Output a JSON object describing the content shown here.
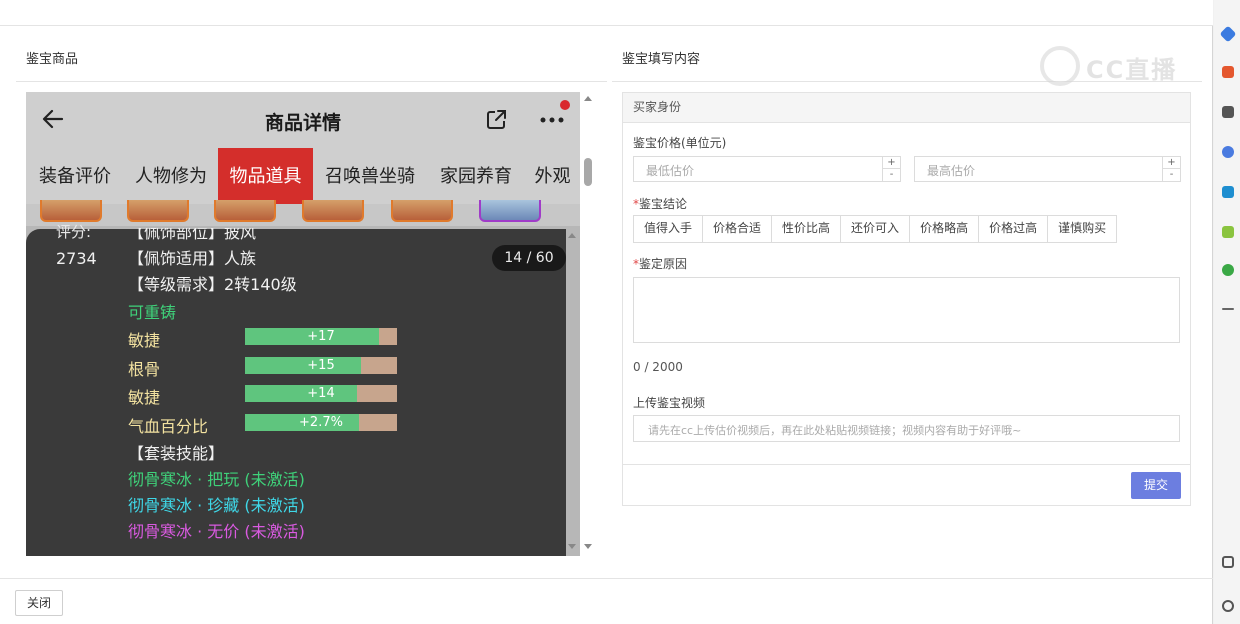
{
  "dialog": {
    "left_title": "鉴宝商品",
    "right_title": "鉴宝填写内容",
    "watermark": "CC直播",
    "close_label": "关闭"
  },
  "phone": {
    "title": "商品详情",
    "tabs": [
      {
        "label": "装备评价",
        "active": false
      },
      {
        "label": "人物修为",
        "active": false
      },
      {
        "label": "物品道具",
        "active": true
      },
      {
        "label": "召唤兽坐骑",
        "active": false
      },
      {
        "label": "家园养育",
        "active": false
      },
      {
        "label": "外观",
        "active": false
      }
    ],
    "card": {
      "score_label": "评分:",
      "score_value": "2734",
      "counter": "14 / 60",
      "line_top_cut": "【佩饰部位】披风",
      "line_race": "【佩饰适用】人族",
      "line_level": "【等级需求】2转140级",
      "recastable": "可重铸",
      "stats": [
        {
          "name": "敏捷",
          "value": "+17",
          "fill": 0.88
        },
        {
          "name": "根骨",
          "value": "+15",
          "fill": 0.76
        },
        {
          "name": "敏捷",
          "value": "+14",
          "fill": 0.74
        },
        {
          "name": "气血百分比",
          "value": "+2.7%",
          "fill": 0.75
        }
      ],
      "set_skill_title": "【套装技能】",
      "set_skills": [
        {
          "text": "彻骨寒冰 · 把玩 (未激活)",
          "color": "#3fd27a"
        },
        {
          "text": "彻骨寒冰 · 珍藏 (未激活)",
          "color": "#3fd8e8"
        },
        {
          "text": "彻骨寒冰 · 无价 (未激活)",
          "color": "#d95ae0"
        }
      ]
    }
  },
  "form": {
    "section": "买家身份",
    "price_label": "鉴宝价格(单位元)",
    "min_placeholder": "最低估价",
    "max_placeholder": "最高估价",
    "conclusion_label": "鉴宝结论",
    "conclusions": [
      "值得入手",
      "价格合适",
      "性价比高",
      "还价可入",
      "价格略高",
      "价格过高",
      "谨慎购买"
    ],
    "reason_label": "鉴定原因",
    "reason_count": "0 / 2000",
    "video_label": "上传鉴宝视频",
    "video_placeholder": "请先在cc上传估价视频后，再在此处粘贴视频链接；视频内容有助于好评哦~",
    "submit_label": "提交"
  },
  "colors": {
    "active_tab": "#d42e2b",
    "submit": "#6c7ee0",
    "stat_fill": "#5fc57e",
    "stat_track": "#c7a58d"
  }
}
